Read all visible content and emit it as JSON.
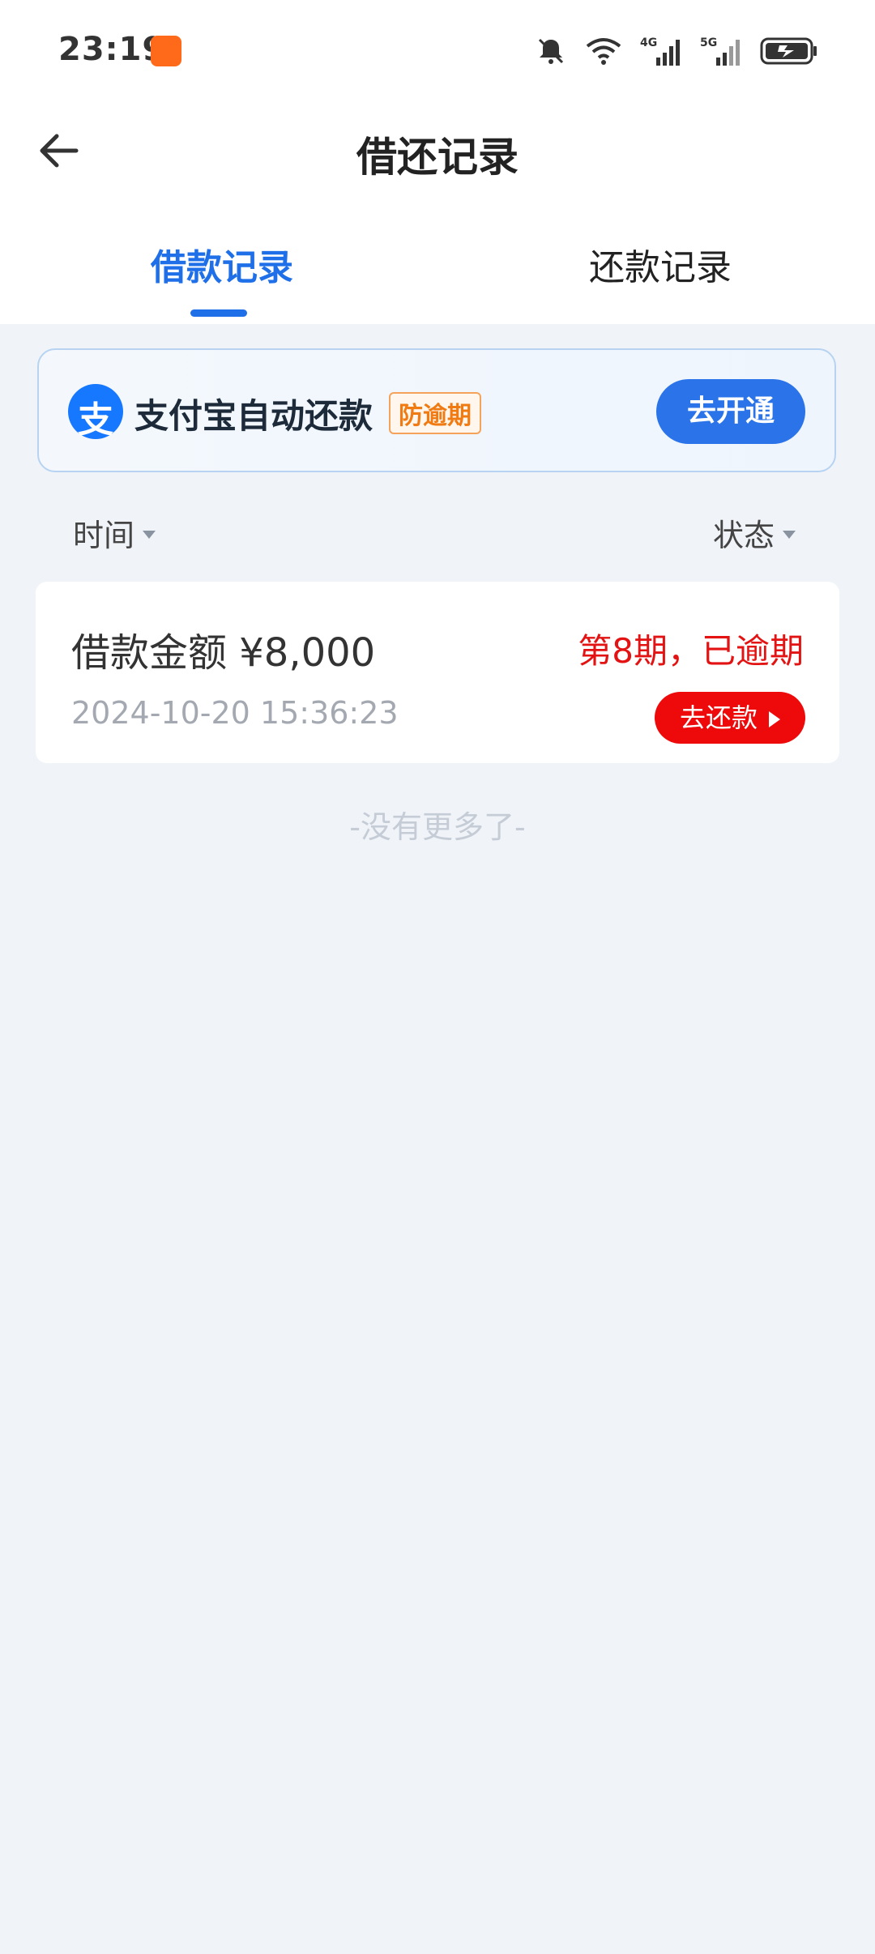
{
  "status_bar": {
    "time": "23:19",
    "icons": [
      "app-badge-icon",
      "mute-icon",
      "wifi-icon",
      "4g-signal-icon",
      "5g-signal-icon",
      "battery-charging-icon"
    ],
    "network_1": "4G",
    "network_2": "5G"
  },
  "header": {
    "title": "借还记录"
  },
  "tabs": [
    {
      "label": "借款记录",
      "active": true
    },
    {
      "label": "还款记录",
      "active": false
    }
  ],
  "promo": {
    "icon_char": "支",
    "text": "支付宝自动还款",
    "tag": "防逾期",
    "button": "去开通"
  },
  "filters": {
    "time": "时间",
    "status": "状态"
  },
  "records": [
    {
      "amount_label": "借款金额 ¥8,000",
      "datetime": "2024-10-20 15:36:23",
      "status": "第8期，已逾期",
      "action": "去还款"
    }
  ],
  "footer": {
    "no_more": "-没有更多了-"
  },
  "colors": {
    "accent": "#1f6fe8",
    "overdue": "#e31313",
    "background": "#f0f4f9"
  }
}
